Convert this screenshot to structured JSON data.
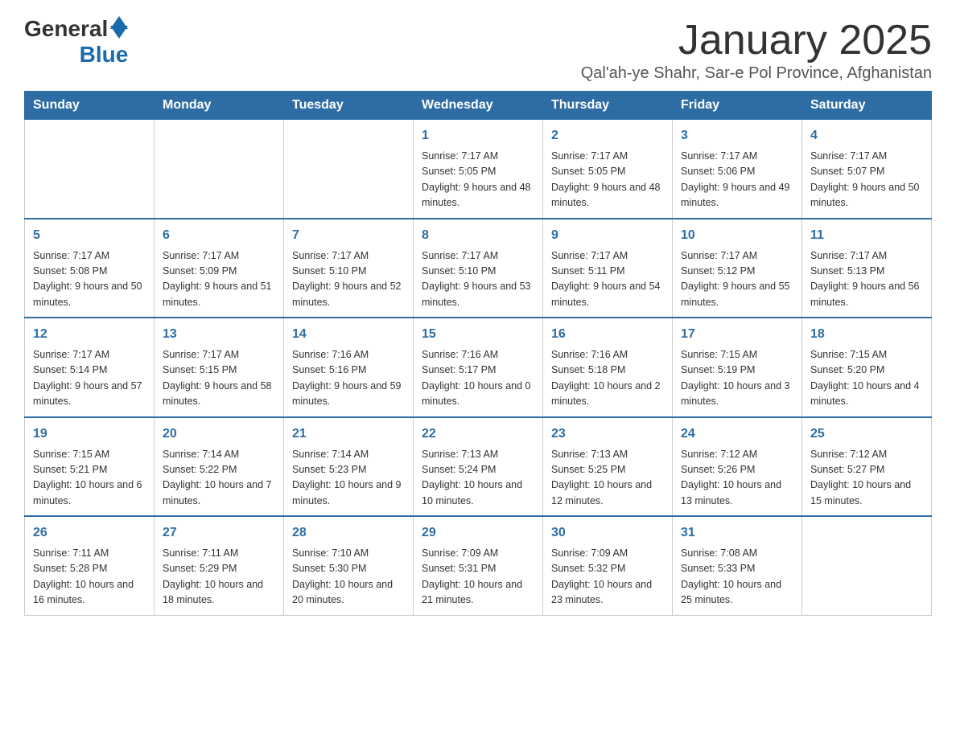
{
  "header": {
    "logo_general": "General",
    "logo_blue": "Blue",
    "month_title": "January 2025",
    "location": "Qal'ah-ye Shahr, Sar-e Pol Province, Afghanistan"
  },
  "weekdays": [
    "Sunday",
    "Monday",
    "Tuesday",
    "Wednesday",
    "Thursday",
    "Friday",
    "Saturday"
  ],
  "rows": [
    [
      {
        "day": "",
        "info": ""
      },
      {
        "day": "",
        "info": ""
      },
      {
        "day": "",
        "info": ""
      },
      {
        "day": "1",
        "info": "Sunrise: 7:17 AM\nSunset: 5:05 PM\nDaylight: 9 hours and 48 minutes."
      },
      {
        "day": "2",
        "info": "Sunrise: 7:17 AM\nSunset: 5:05 PM\nDaylight: 9 hours and 48 minutes."
      },
      {
        "day": "3",
        "info": "Sunrise: 7:17 AM\nSunset: 5:06 PM\nDaylight: 9 hours and 49 minutes."
      },
      {
        "day": "4",
        "info": "Sunrise: 7:17 AM\nSunset: 5:07 PM\nDaylight: 9 hours and 50 minutes."
      }
    ],
    [
      {
        "day": "5",
        "info": "Sunrise: 7:17 AM\nSunset: 5:08 PM\nDaylight: 9 hours and 50 minutes."
      },
      {
        "day": "6",
        "info": "Sunrise: 7:17 AM\nSunset: 5:09 PM\nDaylight: 9 hours and 51 minutes."
      },
      {
        "day": "7",
        "info": "Sunrise: 7:17 AM\nSunset: 5:10 PM\nDaylight: 9 hours and 52 minutes."
      },
      {
        "day": "8",
        "info": "Sunrise: 7:17 AM\nSunset: 5:10 PM\nDaylight: 9 hours and 53 minutes."
      },
      {
        "day": "9",
        "info": "Sunrise: 7:17 AM\nSunset: 5:11 PM\nDaylight: 9 hours and 54 minutes."
      },
      {
        "day": "10",
        "info": "Sunrise: 7:17 AM\nSunset: 5:12 PM\nDaylight: 9 hours and 55 minutes."
      },
      {
        "day": "11",
        "info": "Sunrise: 7:17 AM\nSunset: 5:13 PM\nDaylight: 9 hours and 56 minutes."
      }
    ],
    [
      {
        "day": "12",
        "info": "Sunrise: 7:17 AM\nSunset: 5:14 PM\nDaylight: 9 hours and 57 minutes."
      },
      {
        "day": "13",
        "info": "Sunrise: 7:17 AM\nSunset: 5:15 PM\nDaylight: 9 hours and 58 minutes."
      },
      {
        "day": "14",
        "info": "Sunrise: 7:16 AM\nSunset: 5:16 PM\nDaylight: 9 hours and 59 minutes."
      },
      {
        "day": "15",
        "info": "Sunrise: 7:16 AM\nSunset: 5:17 PM\nDaylight: 10 hours and 0 minutes."
      },
      {
        "day": "16",
        "info": "Sunrise: 7:16 AM\nSunset: 5:18 PM\nDaylight: 10 hours and 2 minutes."
      },
      {
        "day": "17",
        "info": "Sunrise: 7:15 AM\nSunset: 5:19 PM\nDaylight: 10 hours and 3 minutes."
      },
      {
        "day": "18",
        "info": "Sunrise: 7:15 AM\nSunset: 5:20 PM\nDaylight: 10 hours and 4 minutes."
      }
    ],
    [
      {
        "day": "19",
        "info": "Sunrise: 7:15 AM\nSunset: 5:21 PM\nDaylight: 10 hours and 6 minutes."
      },
      {
        "day": "20",
        "info": "Sunrise: 7:14 AM\nSunset: 5:22 PM\nDaylight: 10 hours and 7 minutes."
      },
      {
        "day": "21",
        "info": "Sunrise: 7:14 AM\nSunset: 5:23 PM\nDaylight: 10 hours and 9 minutes."
      },
      {
        "day": "22",
        "info": "Sunrise: 7:13 AM\nSunset: 5:24 PM\nDaylight: 10 hours and 10 minutes."
      },
      {
        "day": "23",
        "info": "Sunrise: 7:13 AM\nSunset: 5:25 PM\nDaylight: 10 hours and 12 minutes."
      },
      {
        "day": "24",
        "info": "Sunrise: 7:12 AM\nSunset: 5:26 PM\nDaylight: 10 hours and 13 minutes."
      },
      {
        "day": "25",
        "info": "Sunrise: 7:12 AM\nSunset: 5:27 PM\nDaylight: 10 hours and 15 minutes."
      }
    ],
    [
      {
        "day": "26",
        "info": "Sunrise: 7:11 AM\nSunset: 5:28 PM\nDaylight: 10 hours and 16 minutes."
      },
      {
        "day": "27",
        "info": "Sunrise: 7:11 AM\nSunset: 5:29 PM\nDaylight: 10 hours and 18 minutes."
      },
      {
        "day": "28",
        "info": "Sunrise: 7:10 AM\nSunset: 5:30 PM\nDaylight: 10 hours and 20 minutes."
      },
      {
        "day": "29",
        "info": "Sunrise: 7:09 AM\nSunset: 5:31 PM\nDaylight: 10 hours and 21 minutes."
      },
      {
        "day": "30",
        "info": "Sunrise: 7:09 AM\nSunset: 5:32 PM\nDaylight: 10 hours and 23 minutes."
      },
      {
        "day": "31",
        "info": "Sunrise: 7:08 AM\nSunset: 5:33 PM\nDaylight: 10 hours and 25 minutes."
      },
      {
        "day": "",
        "info": ""
      }
    ]
  ]
}
